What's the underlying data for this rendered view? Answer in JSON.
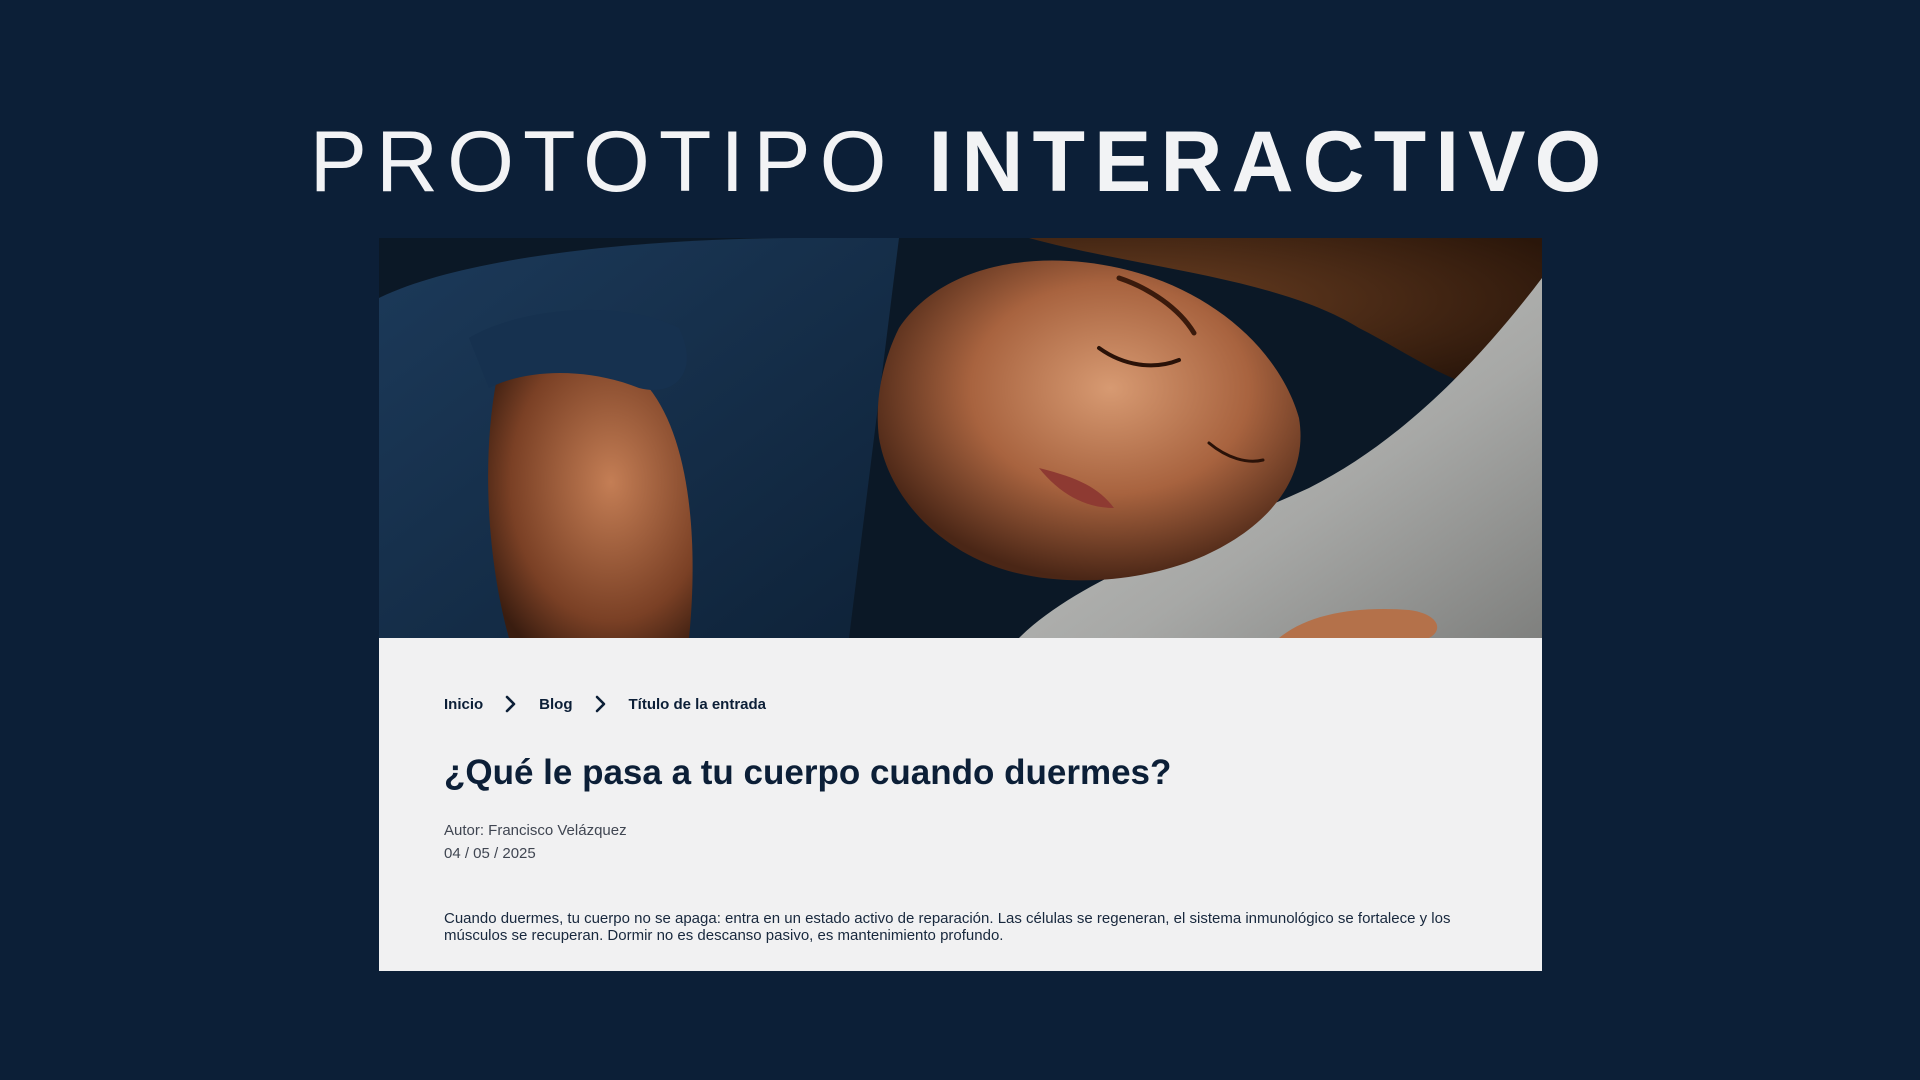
{
  "headline": {
    "light": "PROTOTIPO",
    "bold": "INTERACTIVO"
  },
  "hero": {
    "icon": "sleeping-woman-photo"
  },
  "breadcrumb": {
    "items": [
      "Inicio",
      "Blog",
      "Título de la entrada"
    ],
    "separator_icon": "chevron-right-icon"
  },
  "article": {
    "title": "¿Qué le pasa a tu cuerpo cuando duermes?",
    "author": "Autor: Francisco Velázquez",
    "date": "04 / 05 / 2025",
    "body": "Cuando duermes, tu cuerpo no se apaga: entra en un estado activo de reparación. Las células se regeneran, el sistema inmunológico se fortalece y los músculos se recuperan. Dormir no es descanso pasivo, es mantenimiento profundo."
  },
  "colors": {
    "background": "#0c1f37",
    "card": "#f1f1f2",
    "accent": "#0c1f37"
  }
}
